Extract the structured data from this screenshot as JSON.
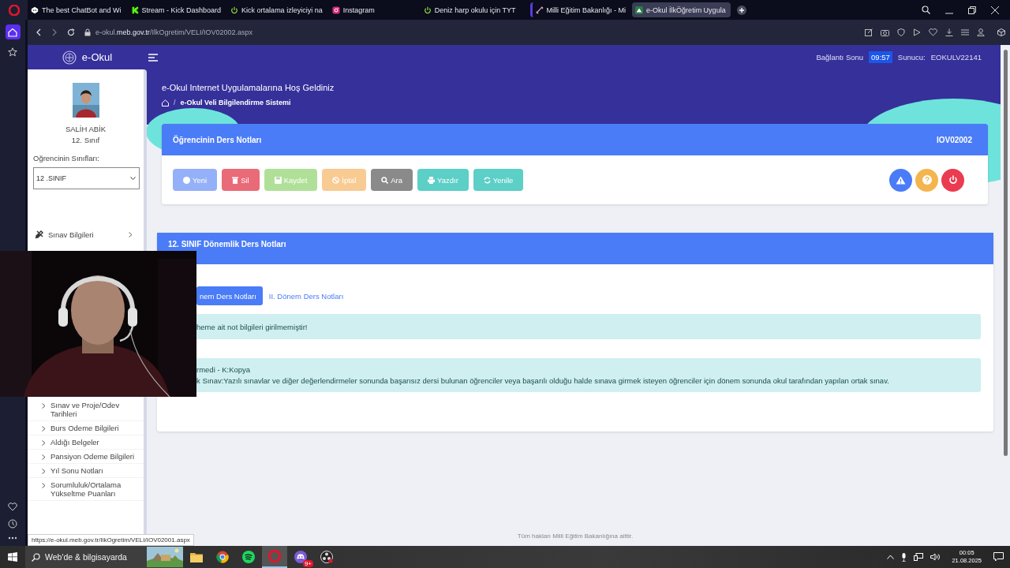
{
  "browser": {
    "tabs": [
      {
        "title": "The best ChatBot and Wi",
        "kind": "chatbot",
        "selected": false
      },
      {
        "title": "Stream - Kick Dashboard",
        "kind": "kick",
        "selected": false
      },
      {
        "title": "Kick ortalama izleyiciyi na",
        "kind": "power",
        "selected": false
      },
      {
        "title": "Instagram",
        "kind": "instagram",
        "selected": false
      },
      {
        "title": "Deniz harp okulu için TYT",
        "kind": "power",
        "selected": false
      },
      {
        "title": "Milli Eğitim Bakanlığı - Mi",
        "kind": "link",
        "selected": false
      },
      {
        "title": "e-Okul İlkÖğretim Uygula",
        "kind": "eokul",
        "selected": true
      }
    ],
    "address": "e-okul.**meb.gov.tr**/IlkOgretim/VELI/IOV02002.aspx",
    "status_url": "https://e-okul.meb.gov.tr/IlkOgretim/VELI/IOV02001.aspx"
  },
  "header": {
    "logo": "e-Okul",
    "session_label": "Bağlantı Sonu",
    "session_time": "09:57",
    "server_label": "Sunucu:",
    "server": "EOKULV22141",
    "welcome": "e-Okul Internet Uygulamalarına Hoş Geldiniz",
    "breadcrumb_separator": "/",
    "breadcrumb": "e-Okul Veli Bilgilendirme Sistemi"
  },
  "student": {
    "name": "SALİH ABİK",
    "class": "12. Sınıf",
    "classes_label": "Oğrencinin Sınıfları:",
    "class_select": "12 .SINIF"
  },
  "sidebar": {
    "items": [
      {
        "label": "Sınav Bilgileri",
        "kind": "section"
      },
      {
        "label": "Sınav ve Proje/Odev Tarihleri",
        "kind": "link"
      },
      {
        "label": "Burs Odeme Bilgileri",
        "kind": "link"
      },
      {
        "label": "Aldığı Belgeler",
        "kind": "link"
      },
      {
        "label": "Pansiyon Odeme Bilgileri",
        "kind": "link"
      },
      {
        "label": "Yıl Sonu Notları",
        "kind": "link"
      },
      {
        "label": "Sorumluluk/Ortalama Yükseltme Puanları",
        "kind": "link"
      }
    ]
  },
  "grades_card": {
    "title": "Öğrencinin Ders Notları",
    "code": "IOV02002",
    "buttons": [
      {
        "label": "Yeni",
        "kind": "new",
        "disabled": true
      },
      {
        "label": "Sil",
        "kind": "delete",
        "disabled": false
      },
      {
        "label": "Kaydet",
        "kind": "save",
        "disabled": true
      },
      {
        "label": "İptal",
        "kind": "cancel",
        "disabled": true
      },
      {
        "label": "Ara",
        "kind": "search",
        "disabled": false
      },
      {
        "label": "Yazdır",
        "kind": "print",
        "disabled": false
      },
      {
        "label": "Yenile",
        "kind": "refresh",
        "disabled": false
      }
    ],
    "round_buttons": [
      {
        "kind": "warning"
      },
      {
        "kind": "help"
      },
      {
        "kind": "power"
      }
    ]
  },
  "term_card": {
    "title": "12. SINIF Dönemlik Ders Notları",
    "tabs": [
      {
        "label": "nem Ders Notları",
        "selected": true
      },
      {
        "label": "II. Dönem Ders Notları",
        "selected": false
      }
    ],
    "notice": "heme ait not bilgileri girilmemiştir!",
    "legend": [
      "rmedi - K:Kopya",
      "k Sınav:Yazılı sınavlar ve diğer değerlendirmeler sonunda başarısız dersi bulunan öğrenciler veya başarılı olduğu halde sınava girmek isteyen öğrenciler için dönem sonunda okul tarafından yapılan ortak sınav."
    ]
  },
  "footer": "Tüm hakları Milli Eğitim Bakanlığına aittir.",
  "taskbar": {
    "search_placeholder": "Web'de & bilgisayarda",
    "apps": [
      {
        "kind": "folder",
        "selected": false
      },
      {
        "kind": "chrome",
        "selected": false
      },
      {
        "kind": "spotify",
        "selected": false
      },
      {
        "kind": "opera",
        "selected": true
      },
      {
        "kind": "discord",
        "selected": false,
        "badge": "9+"
      },
      {
        "kind": "obs",
        "selected": false
      }
    ],
    "time": "00:05",
    "date": "21.08.2025"
  }
}
